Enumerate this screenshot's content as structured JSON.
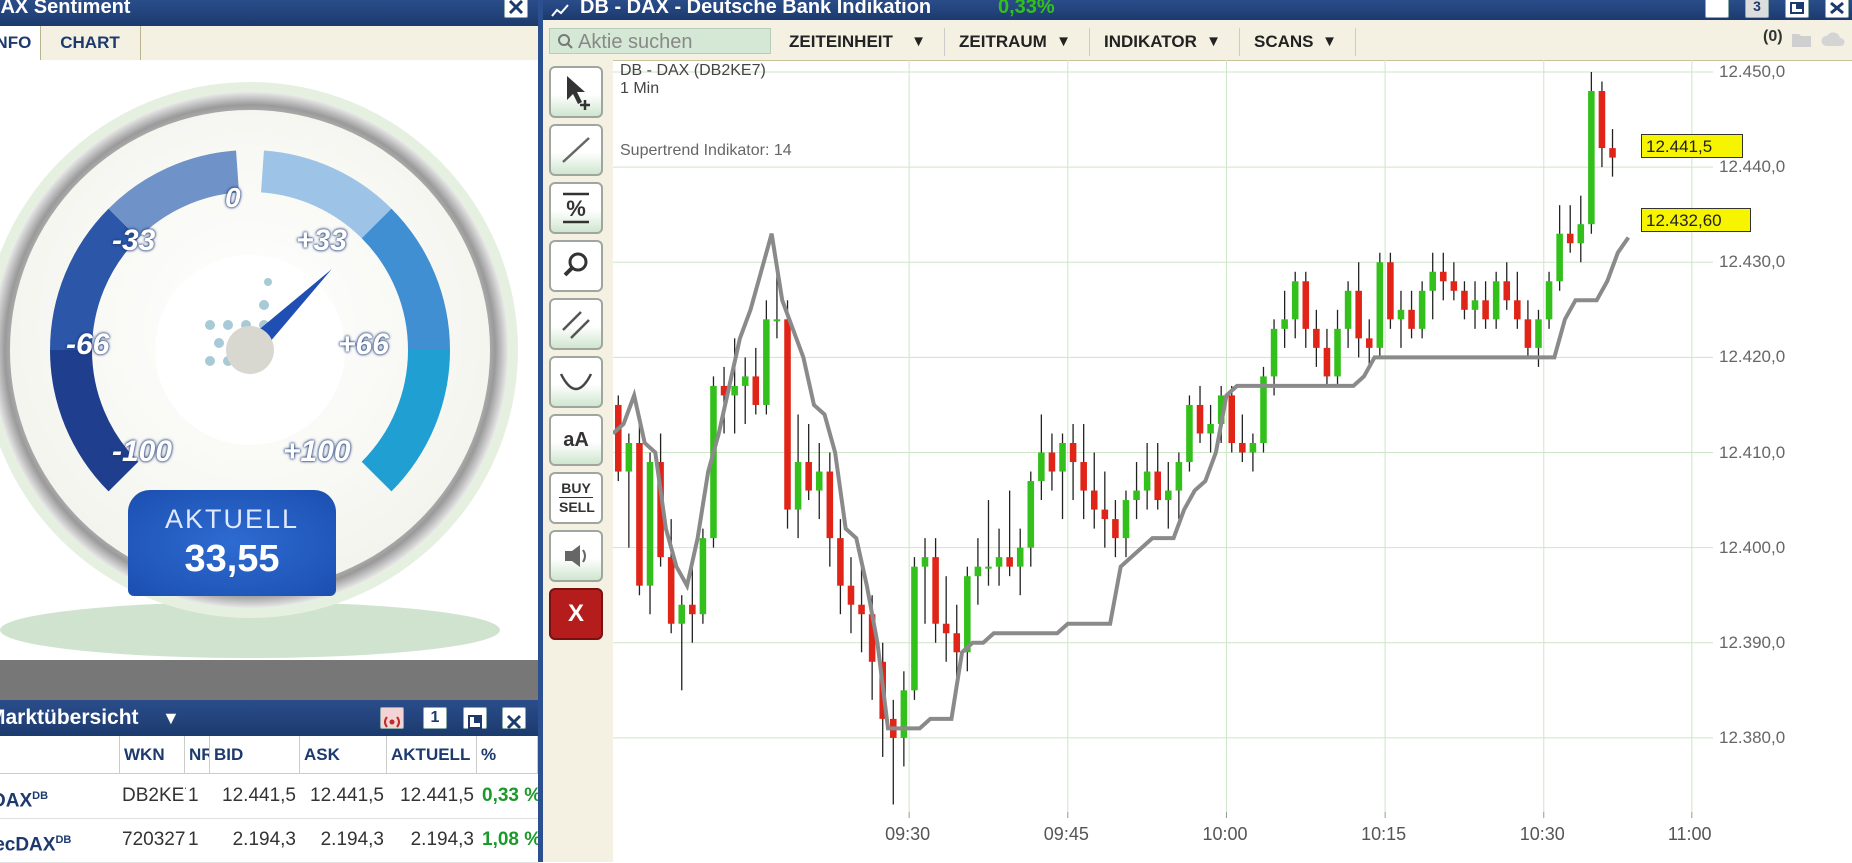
{
  "sentiment_window": {
    "title": "DAX Sentiment",
    "tabs": [
      {
        "label": "INFO",
        "active": true
      },
      {
        "label": "CHART",
        "active": false
      }
    ],
    "gauge": {
      "labels": [
        "0",
        "-33",
        "+33",
        "-66",
        "+66",
        "-100",
        "+100"
      ],
      "aktuell_label": "AKTUELL",
      "aktuell_value": "33,55",
      "needle_value": 33.55
    }
  },
  "market_window": {
    "title": "Marktübersicht",
    "badge": "1",
    "columns": [
      "",
      "WKN",
      "NR",
      "BID",
      "ASK",
      "AKTUELL",
      "%"
    ],
    "rows": [
      {
        "name": "DAX",
        "sup": "DB",
        "wkn": "DB2KE7",
        "nr": "1",
        "bid": "12.441,5",
        "ask": "12.441,5",
        "aktuell": "12.441,5",
        "pct": "0,33 %"
      },
      {
        "name": "TecDAX",
        "sup": "DB",
        "wkn": "720327",
        "nr": "1",
        "bid": "2.194,3",
        "ask": "2.194,3",
        "aktuell": "2.194,3",
        "pct": "1,08 %"
      }
    ]
  },
  "chart_window": {
    "title": "DB - DAX - Deutsche Bank Indikation",
    "change": "0,33%",
    "badge": "3",
    "search_placeholder": "Aktie suchen",
    "menus": [
      "ZEITEINHEIT",
      "ZEITRAUM",
      "INDIKATOR",
      "SCANS"
    ],
    "count": "(0)",
    "tools": [
      "pointer-add",
      "line",
      "percent",
      "zoom",
      "parallel-lines",
      "curve",
      "aA",
      "BUY SELL",
      "sound",
      "X"
    ],
    "tool_text": {
      "text": "aA",
      "buy": "BUY",
      "sell": "SELL",
      "close": "X"
    },
    "instrument": "DB - DAX (DB2KE7)",
    "interval": "1 Min",
    "indicator": "Supertrend Indikator: 14",
    "last_price": "12.441,5",
    "supertrend_value": "12.432,60",
    "colors": {
      "up": "#33c01c",
      "down": "#e02418",
      "supertrend": "#8a8a8a",
      "grid": "#cfe5c8"
    }
  },
  "chart_data": {
    "type": "candlestick",
    "title": "DB - DAX (DB2KE7)",
    "ylim": [
      12372,
      12450
    ],
    "y_ticks": [
      12380,
      12390,
      12400,
      12410,
      12420,
      12430,
      12440,
      12450
    ],
    "y_tick_labels": [
      "12.380,0",
      "12.390,0",
      "12.400,0",
      "12.410,0",
      "12.420,0",
      "12.430,0",
      "12.440,0",
      "12.450,0"
    ],
    "x_ticks": [
      "09:30",
      "09:45",
      "10:00",
      "10:15",
      "10:30",
      "11:00"
    ],
    "x_tick_positions": [
      28,
      43,
      58,
      73,
      88,
      102
    ],
    "x_range": [
      0,
      104
    ],
    "candles": [
      [
        12415,
        12416,
        12407,
        12408
      ],
      [
        12408,
        12412,
        12400,
        12411
      ],
      [
        12411,
        12413,
        12395,
        12396
      ],
      [
        12396,
        12410,
        12393,
        12409
      ],
      [
        12409,
        12412,
        12398,
        12399
      ],
      [
        12399,
        12403,
        12391,
        12392
      ],
      [
        12392,
        12395,
        12385,
        12394
      ],
      [
        12394,
        12398,
        12390,
        12393
      ],
      [
        12393,
        12402,
        12392,
        12401
      ],
      [
        12401,
        12418,
        12400,
        12417
      ],
      [
        12417,
        12419,
        12412,
        12416
      ],
      [
        12416,
        12422,
        12412,
        12417
      ],
      [
        12417,
        12420,
        12413,
        12418
      ],
      [
        12418,
        12421,
        12414,
        12415
      ],
      [
        12415,
        12426,
        12414,
        12424
      ],
      [
        12424,
        12429,
        12422,
        12424
      ],
      [
        12424,
        12426,
        12402,
        12404
      ],
      [
        12404,
        12414,
        12401,
        12409
      ],
      [
        12409,
        12413,
        12405,
        12406
      ],
      [
        12406,
        12411,
        12403,
        12408
      ],
      [
        12408,
        12410,
        12398,
        12401
      ],
      [
        12401,
        12403,
        12393,
        12396
      ],
      [
        12396,
        12399,
        12391,
        12394
      ],
      [
        12394,
        12398,
        12389,
        12393
      ],
      [
        12393,
        12395,
        12384,
        12388
      ],
      [
        12388,
        12390,
        12378,
        12382
      ],
      [
        12382,
        12384,
        12373,
        12380
      ],
      [
        12380,
        12387,
        12377,
        12385
      ],
      [
        12385,
        12399,
        12384,
        12398
      ],
      [
        12398,
        12401,
        12392,
        12399
      ],
      [
        12399,
        12401,
        12390,
        12392
      ],
      [
        12392,
        12397,
        12388,
        12391
      ],
      [
        12391,
        12394,
        12386,
        12389
      ],
      [
        12389,
        12398,
        12387,
        12397
      ],
      [
        12397,
        12401,
        12394,
        12398
      ],
      [
        12398,
        12405,
        12396,
        12398
      ],
      [
        12398,
        12402,
        12396,
        12399
      ],
      [
        12399,
        12406,
        12397,
        12398
      ],
      [
        12398,
        12402,
        12395,
        12400
      ],
      [
        12400,
        12408,
        12398,
        12407
      ],
      [
        12407,
        12414,
        12405,
        12410
      ],
      [
        12410,
        12412,
        12406,
        12408
      ],
      [
        12408,
        12412,
        12403,
        12411
      ],
      [
        12411,
        12413,
        12405,
        12409
      ],
      [
        12409,
        12413,
        12403,
        12406
      ],
      [
        12406,
        12410,
        12402,
        12404
      ],
      [
        12404,
        12408,
        12400,
        12403
      ],
      [
        12403,
        12405,
        12399,
        12401
      ],
      [
        12401,
        12406,
        12399,
        12405
      ],
      [
        12405,
        12409,
        12403,
        12406
      ],
      [
        12406,
        12411,
        12404,
        12408
      ],
      [
        12408,
        12411,
        12404,
        12405
      ],
      [
        12405,
        12409,
        12402,
        12406
      ],
      [
        12406,
        12410,
        12403,
        12409
      ],
      [
        12409,
        12416,
        12408,
        12415
      ],
      [
        12415,
        12417,
        12411,
        12412
      ],
      [
        12412,
        12415,
        12410,
        12413
      ],
      [
        12413,
        12417,
        12411,
        12416
      ],
      [
        12416,
        12417,
        12410,
        12411
      ],
      [
        12411,
        12414,
        12409,
        12410
      ],
      [
        12410,
        12412,
        12408,
        12411
      ],
      [
        12411,
        12419,
        12410,
        12418
      ],
      [
        12418,
        12424,
        12416,
        12423
      ],
      [
        12423,
        12427,
        12421,
        12424
      ],
      [
        12424,
        12429,
        12422,
        12428
      ],
      [
        12428,
        12429,
        12421,
        12423
      ],
      [
        12423,
        12425,
        12419,
        12421
      ],
      [
        12421,
        12423,
        12417,
        12418
      ],
      [
        12418,
        12425,
        12417,
        12423
      ],
      [
        12423,
        12428,
        12421,
        12427
      ],
      [
        12427,
        12430,
        12420,
        12422
      ],
      [
        12422,
        12424,
        12419,
        12421
      ],
      [
        12421,
        12431,
        12420,
        12430
      ],
      [
        12430,
        12431,
        12423,
        12424
      ],
      [
        12424,
        12427,
        12421,
        12425
      ],
      [
        12425,
        12427,
        12422,
        12423
      ],
      [
        12423,
        12428,
        12422,
        12427
      ],
      [
        12427,
        12431,
        12424,
        12429
      ],
      [
        12429,
        12431,
        12426,
        12428
      ],
      [
        12428,
        12430,
        12426,
        12427
      ],
      [
        12427,
        12428,
        12424,
        12425
      ],
      [
        12425,
        12428,
        12423,
        12426
      ],
      [
        12426,
        12428,
        12423,
        12424
      ],
      [
        12424,
        12429,
        12423,
        12428
      ],
      [
        12428,
        12430,
        12425,
        12426
      ],
      [
        12426,
        12429,
        12423,
        12424
      ],
      [
        12424,
        12426,
        12420,
        12421
      ],
      [
        12421,
        12425,
        12419,
        12424
      ],
      [
        12424,
        12429,
        12423,
        12428
      ],
      [
        12428,
        12436,
        12427,
        12433
      ],
      [
        12433,
        12436,
        12431,
        12432
      ],
      [
        12432,
        12437,
        12430,
        12434
      ],
      [
        12434,
        12450,
        12433,
        12448
      ],
      [
        12448,
        12449,
        12440,
        12442
      ],
      [
        12442,
        12444,
        12439,
        12441
      ]
    ],
    "candle_x_start": 0.5,
    "candle_x_step": 1.0,
    "supertrend": [
      [
        0,
        12412
      ],
      [
        1,
        12413
      ],
      [
        2,
        12416
      ],
      [
        3,
        12411
      ],
      [
        4,
        12410
      ],
      [
        5,
        12402
      ],
      [
        6,
        12398
      ],
      [
        7,
        12396
      ],
      [
        8,
        12401
      ],
      [
        9,
        12408
      ],
      [
        10,
        12412
      ],
      [
        11,
        12417
      ],
      [
        12,
        12422
      ],
      [
        13,
        12425
      ],
      [
        14,
        12429
      ],
      [
        15,
        12433
      ],
      [
        16,
        12426
      ],
      [
        17,
        12423
      ],
      [
        18,
        12420
      ],
      [
        19,
        12415
      ],
      [
        20,
        12414
      ],
      [
        21,
        12410
      ],
      [
        22,
        12402
      ],
      [
        23,
        12401
      ],
      [
        24,
        12396
      ],
      [
        25,
        12390
      ],
      [
        26,
        12381
      ],
      [
        27,
        12381
      ],
      [
        28,
        12381
      ],
      [
        29,
        12381
      ],
      [
        30,
        12382
      ],
      [
        31,
        12382
      ],
      [
        32,
        12382
      ],
      [
        33,
        12389
      ],
      [
        34,
        12390
      ],
      [
        35,
        12390
      ],
      [
        36,
        12391
      ],
      [
        37,
        12391
      ],
      [
        38,
        12391
      ],
      [
        39,
        12391
      ],
      [
        40,
        12391
      ],
      [
        41,
        12391
      ],
      [
        42,
        12391
      ],
      [
        43,
        12392
      ],
      [
        44,
        12392
      ],
      [
        45,
        12392
      ],
      [
        46,
        12392
      ],
      [
        47,
        12392
      ],
      [
        48,
        12398
      ],
      [
        49,
        12399
      ],
      [
        50,
        12400
      ],
      [
        51,
        12401
      ],
      [
        52,
        12401
      ],
      [
        53,
        12401
      ],
      [
        54,
        12404
      ],
      [
        55,
        12406
      ],
      [
        56,
        12407
      ],
      [
        57,
        12410
      ],
      [
        58,
        12416
      ],
      [
        59,
        12417
      ],
      [
        60,
        12417
      ],
      [
        61,
        12417
      ],
      [
        62,
        12417
      ],
      [
        63,
        12417
      ],
      [
        64,
        12417
      ],
      [
        65,
        12417
      ],
      [
        66,
        12417
      ],
      [
        67,
        12417
      ],
      [
        68,
        12417
      ],
      [
        69,
        12417
      ],
      [
        70,
        12417
      ],
      [
        71,
        12418
      ],
      [
        72,
        12420
      ],
      [
        73,
        12420
      ],
      [
        74,
        12420
      ],
      [
        75,
        12420
      ],
      [
        76,
        12420
      ],
      [
        77,
        12420
      ],
      [
        78,
        12420
      ],
      [
        79,
        12420
      ],
      [
        80,
        12420
      ],
      [
        81,
        12420
      ],
      [
        82,
        12420
      ],
      [
        83,
        12420
      ],
      [
        84,
        12420
      ],
      [
        85,
        12420
      ],
      [
        86,
        12420
      ],
      [
        87,
        12420
      ],
      [
        88,
        12420
      ],
      [
        89,
        12420
      ],
      [
        90,
        12424
      ],
      [
        91,
        12426
      ],
      [
        92,
        12426
      ],
      [
        93,
        12426
      ],
      [
        94,
        12428
      ],
      [
        95,
        12431
      ],
      [
        96,
        12432.6
      ]
    ]
  }
}
